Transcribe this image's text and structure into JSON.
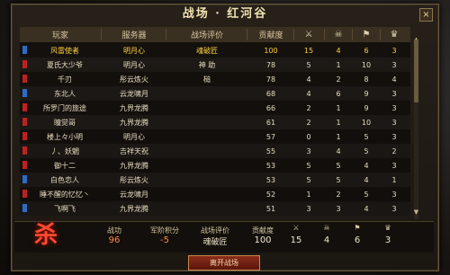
{
  "title": "战场 · 红河谷",
  "close_label": "×",
  "columns": {
    "player": "玩家",
    "server": "服务器",
    "rating": "战场评价",
    "contribution": "贡献度",
    "icons": [
      "crossed-swords-icon",
      "skull-icon",
      "banner-icon",
      "mask-icon"
    ]
  },
  "rows": [
    {
      "flag": "blue",
      "name": "风雷使者",
      "server": "明月心",
      "rating": "魂破匠",
      "contribution": "100",
      "kills": "15",
      "deaths": "4",
      "assists": "6",
      "misc": "3",
      "self": true
    },
    {
      "flag": "red",
      "name": "夏氏大少爷",
      "server": "明月心",
      "rating": "神 助",
      "contribution": "78",
      "kills": "5",
      "deaths": "1",
      "assists": "10",
      "misc": "3",
      "self": false
    },
    {
      "flag": "red",
      "name": "千刃",
      "server": "彤云炼火",
      "rating": "槌",
      "contribution": "78",
      "kills": "4",
      "deaths": "2",
      "assists": "8",
      "misc": "4",
      "self": false
    },
    {
      "flag": "blue",
      "name": "东北人",
      "server": "云龙啸月",
      "rating": "",
      "contribution": "68",
      "kills": "4",
      "deaths": "6",
      "assists": "9",
      "misc": "3",
      "self": false
    },
    {
      "flag": "red",
      "name": "所罗门的旅途",
      "server": "九界龙腾",
      "rating": "",
      "contribution": "66",
      "kills": "2",
      "deaths": "1",
      "assists": "9",
      "misc": "3",
      "self": false
    },
    {
      "flag": "red",
      "name": "瞳觉哥",
      "server": "九界龙腾",
      "rating": "",
      "contribution": "61",
      "kills": "2",
      "deaths": "1",
      "assists": "10",
      "misc": "3",
      "self": false
    },
    {
      "flag": "red",
      "name": "楼上々小明",
      "server": "明月心",
      "rating": "",
      "contribution": "57",
      "kills": "0",
      "deaths": "1",
      "assists": "5",
      "misc": "3",
      "self": false
    },
    {
      "flag": "red",
      "name": "丿、妖魍",
      "server": "吉祥天祝",
      "rating": "",
      "contribution": "55",
      "kills": "3",
      "deaths": "4",
      "assists": "5",
      "misc": "2",
      "self": false
    },
    {
      "flag": "red",
      "name": "御十二",
      "server": "九界龙腾",
      "rating": "",
      "contribution": "53",
      "kills": "5",
      "deaths": "5",
      "assists": "4",
      "misc": "3",
      "self": false
    },
    {
      "flag": "blue",
      "name": "白色恋人",
      "server": "彤云炼火",
      "rating": "",
      "contribution": "53",
      "kills": "5",
      "deaths": "5",
      "assists": "4",
      "misc": "1",
      "self": false
    },
    {
      "flag": "red",
      "name": "睡不醒的忆忆丶",
      "server": "云龙啸月",
      "rating": "",
      "contribution": "52",
      "kills": "1",
      "deaths": "2",
      "assists": "5",
      "misc": "3",
      "self": false
    },
    {
      "flag": "blue",
      "name": "飞啊飞",
      "server": "九界龙腾",
      "rating": "",
      "contribution": "51",
      "kills": "3",
      "deaths": "3",
      "assists": "4",
      "misc": "3",
      "self": false
    }
  ],
  "summary": {
    "emblem": "杀",
    "battle_label": "战功",
    "battle_value": "96",
    "rank_label": "军阶积分",
    "rank_value": "-5",
    "rating_label": "战场评价",
    "rating_value": "魂破匠",
    "contribution_label": "贡献度",
    "contribution_value": "100",
    "kills": "15",
    "deaths": "4",
    "assists": "6",
    "misc": "3"
  },
  "leave_button": "离开战场",
  "colors": {
    "highlight": "#ffd040",
    "red_flag": "#c02020",
    "blue_flag": "#2a6cc8",
    "button": "#8a2c1a"
  }
}
